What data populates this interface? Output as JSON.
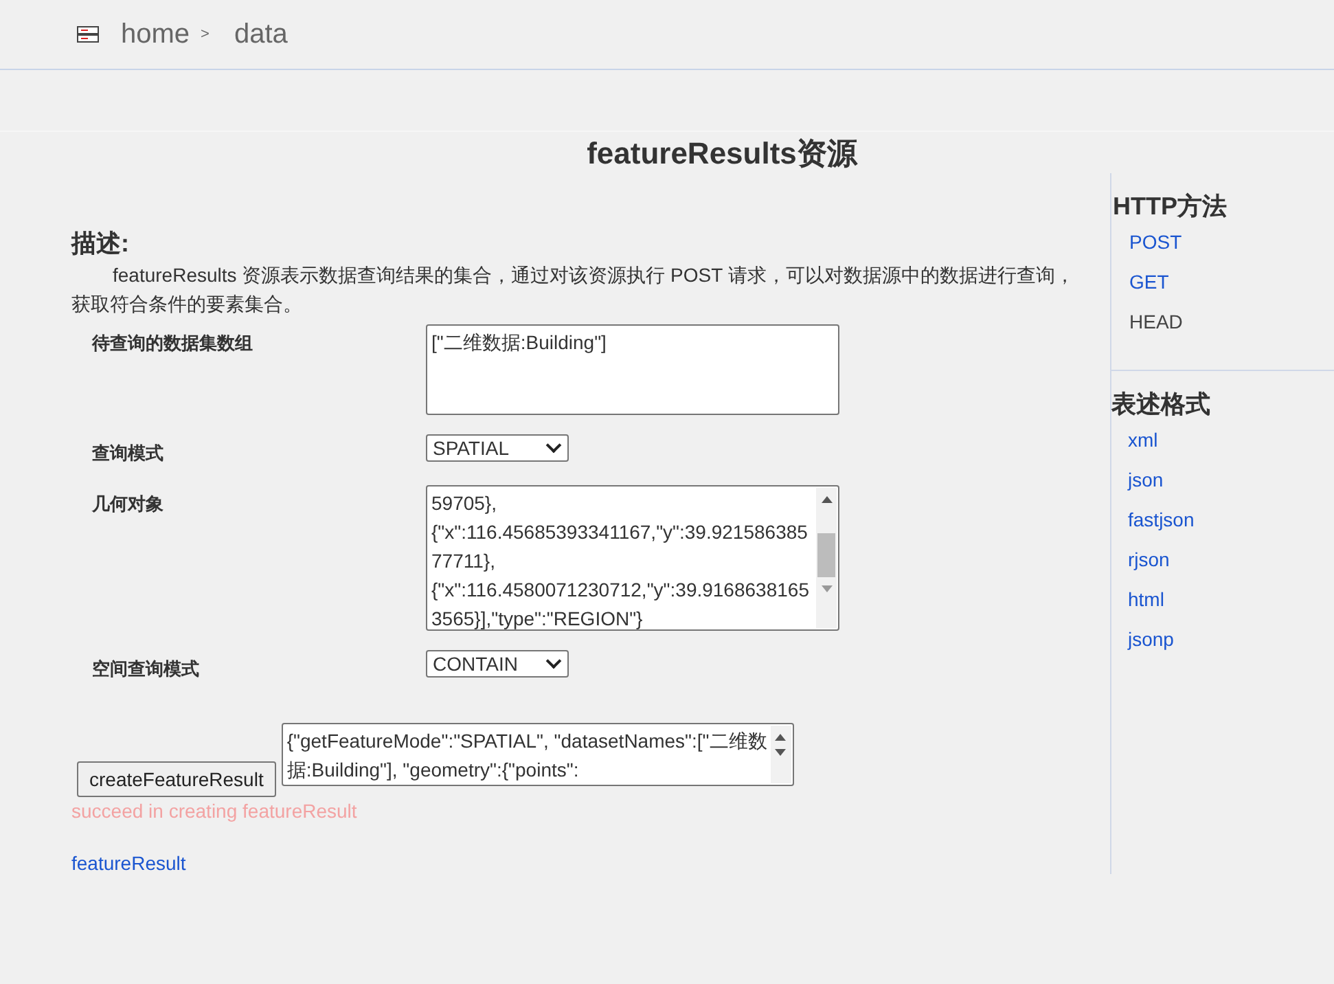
{
  "breadcrumb": [
    {
      "label": "home",
      "separator": ">"
    },
    {
      "label": "data"
    }
  ],
  "title": "featureResults资源",
  "description": {
    "heading": "描述:",
    "text": "featureResults 资源表示数据查询结果的集合，通过对该资源执行 POST 请求，可以对数据源中的数据进行查询，获取符合条件的要素集合。"
  },
  "form": [
    {
      "kind": "textarea",
      "label": "待查询的数据集数组",
      "value": "[\"二维数据:Building\"]",
      "scrollbar": false
    },
    {
      "kind": "select",
      "label": "查询模式",
      "value": "SPATIAL"
    },
    {
      "kind": "textarea",
      "label": "几何对象",
      "value": "59705},\n{\"x\":116.45685393341167,\"y\":39.921586385\n77711},\n{\"x\":116.4580071230712,\"y\":39.9168638165\n3565}],\"type\":\"REGION\"}",
      "scrollbar": true
    },
    {
      "kind": "select",
      "label": "空间查询模式",
      "value": "CONTAIN"
    }
  ],
  "create": {
    "button": "createFeatureResult",
    "request": "{\"getFeatureMode\":\"SPATIAL\", \"datasetNames\":[\"二维数据:Building\"], \"geometry\":{\"points\":",
    "message": "succeed in creating featureResult",
    "result_link": "featureResult"
  },
  "sidebar": [
    {
      "heading": "HTTP方法",
      "items": [
        {
          "label": "POST",
          "disabled": false
        },
        {
          "label": "GET",
          "disabled": false
        },
        {
          "label": "HEAD",
          "disabled": true
        }
      ]
    },
    {
      "heading": "表述格式",
      "items": [
        {
          "label": "xml",
          "disabled": false
        },
        {
          "label": "json",
          "disabled": false
        },
        {
          "label": "fastjson",
          "disabled": false
        },
        {
          "label": "rjson",
          "disabled": false
        },
        {
          "label": "html",
          "disabled": false
        },
        {
          "label": "jsonp",
          "disabled": false
        }
      ]
    }
  ]
}
